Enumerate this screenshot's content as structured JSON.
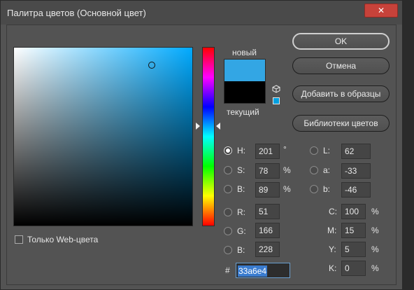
{
  "window": {
    "title": "Палитра цветов (Основной цвет)",
    "close_glyph": "✕"
  },
  "swatches": {
    "new_label": "новый",
    "current_label": "текущий"
  },
  "buttons": {
    "ok": "OK",
    "cancel": "Отмена",
    "add_to_swatches": "Добавить в образцы",
    "color_libraries": "Библиотеки цветов"
  },
  "hsb": {
    "h": {
      "label": "H:",
      "value": "201",
      "unit": "°",
      "selected": true
    },
    "s": {
      "label": "S:",
      "value": "78",
      "unit": "%"
    },
    "b": {
      "label": "B:",
      "value": "89",
      "unit": "%"
    }
  },
  "rgb": {
    "r": {
      "label": "R:",
      "value": "51"
    },
    "g": {
      "label": "G:",
      "value": "166"
    },
    "b": {
      "label": "B:",
      "value": "228"
    }
  },
  "lab": {
    "l": {
      "label": "L:",
      "value": "62"
    },
    "a": {
      "label": "a:",
      "value": "-33"
    },
    "b": {
      "label": "b:",
      "value": "-46"
    }
  },
  "cmyk": {
    "c": {
      "label": "C:",
      "value": "100",
      "unit": "%"
    },
    "m": {
      "label": "M:",
      "value": "15",
      "unit": "%"
    },
    "y": {
      "label": "Y:",
      "value": "5",
      "unit": "%"
    },
    "k": {
      "label": "K:",
      "value": "0",
      "unit": "%"
    }
  },
  "hex": {
    "label": "#",
    "value": "33a6e4"
  },
  "web_only": {
    "label": "Только Web-цвета",
    "checked": false
  },
  "colors": {
    "new": "#33a6e4",
    "current": "#000000",
    "field_hue": "#00aaff"
  },
  "icons": {
    "cube": "cube-icon",
    "close": "close-icon"
  }
}
